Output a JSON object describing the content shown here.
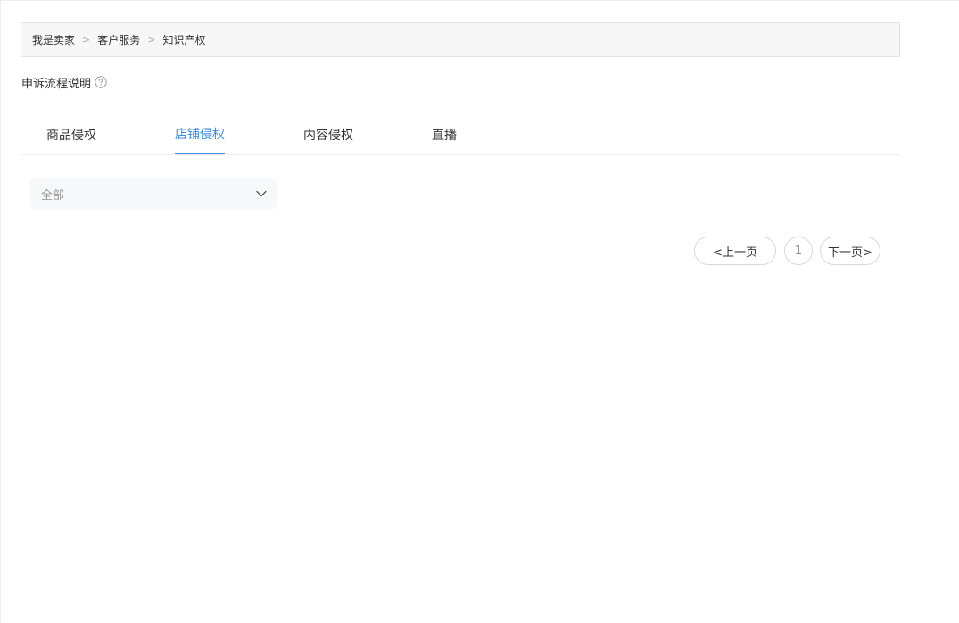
{
  "breadcrumb": {
    "items": [
      "我是卖家",
      "客户服务",
      "知识产权"
    ],
    "separator": ">"
  },
  "appeal": {
    "label": "申诉流程说明",
    "icon": "help-circle-icon"
  },
  "tabs": [
    {
      "label": "商品侵权",
      "active": false
    },
    {
      "label": "店铺侵权",
      "active": true
    },
    {
      "label": "内容侵权",
      "active": false
    },
    {
      "label": "直播",
      "active": false
    }
  ],
  "filter": {
    "selected": "全部",
    "icon": "chevron-down-icon"
  },
  "pagination": {
    "prev_label": "<上一页",
    "current_page": "1",
    "next_label": "下一页>"
  },
  "colors": {
    "accent": "#3a8ee6",
    "text": "#333333",
    "muted": "#999999",
    "border": "#d9d9d9"
  }
}
